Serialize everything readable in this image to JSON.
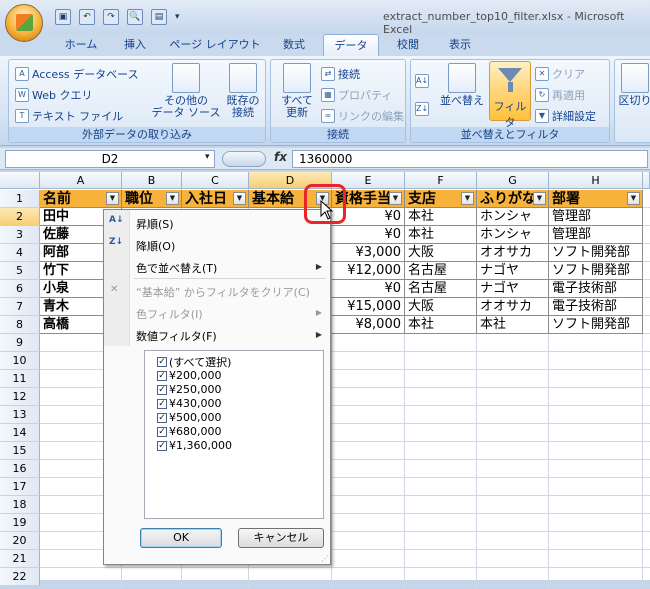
{
  "window": {
    "title": "extract_number_top10_filter.xlsx - Microsoft Excel"
  },
  "tabs": [
    "ホーム",
    "挿入",
    "ページ レイアウト",
    "数式",
    "データ",
    "校閲",
    "表示"
  ],
  "ribbon": {
    "ext": {
      "access": "Access データベース",
      "web": "Web クエリ",
      "text": "テキスト ファイル",
      "other": "その他の",
      "other2": "データ ソース",
      "existing": "既存の",
      "existing2": "接続",
      "label": "外部データの取り込み"
    },
    "conn": {
      "refresh": "すべて",
      "refresh2": "更新",
      "connections": "接続",
      "properties": "プロパティ",
      "links": "リンクの編集",
      "label": "接続"
    },
    "sort": {
      "asc": "A→Z",
      "desc": "Z→A",
      "sort": "並べ替え",
      "filter": "フィルタ",
      "clear": "クリア",
      "reapply": "再適用",
      "advanced": "詳細設定",
      "label": "並べ替えとフィルタ"
    },
    "tools": {
      "split": "区切り"
    }
  },
  "formulabar": {
    "namebox": "D2",
    "fx": "fx",
    "value": "1360000"
  },
  "columns": [
    "A",
    "B",
    "C",
    "D",
    "E",
    "F",
    "G",
    "H"
  ],
  "rows": [
    "1",
    "2",
    "3",
    "4",
    "5",
    "6",
    "7",
    "8",
    "9",
    "10",
    "11",
    "12",
    "13",
    "14",
    "15",
    "16",
    "17",
    "18",
    "19",
    "20",
    "21",
    "22"
  ],
  "headers": [
    "名前",
    "職位",
    "入社日",
    "基本給",
    "資格手当",
    "支店",
    "ふりがな",
    "部署"
  ],
  "table": [
    {
      "name": "田中",
      "allow": "¥0",
      "branch": "本社",
      "kana": "ホンシャ",
      "dept": "管理部"
    },
    {
      "name": "佐藤",
      "allow": "¥0",
      "branch": "本社",
      "kana": "ホンシャ",
      "dept": "管理部"
    },
    {
      "name": "阿部",
      "allow": "¥3,000",
      "branch": "大阪",
      "kana": "オオサカ",
      "dept": "ソフト開発部"
    },
    {
      "name": "竹下",
      "allow": "¥12,000",
      "branch": "名古屋",
      "kana": "ナゴヤ",
      "dept": "ソフト開発部"
    },
    {
      "name": "小泉",
      "allow": "¥0",
      "branch": "名古屋",
      "kana": "ナゴヤ",
      "dept": "電子技術部"
    },
    {
      "name": "青木",
      "allow": "¥15,000",
      "branch": "大阪",
      "kana": "オオサカ",
      "dept": "電子技術部"
    },
    {
      "name": "高橋",
      "allow": "¥8,000",
      "branch": "本社",
      "kana": "本社",
      "dept": "ソフト開発部"
    }
  ],
  "menu": {
    "sort_asc": "昇順(S)",
    "sort_desc": "降順(O)",
    "sort_color": "色で並べ替え(T)",
    "clear": "“基本給” からフィルタをクリア(C)",
    "color_filter": "色フィルタ(I)",
    "number_filter": "数値フィルタ(F)",
    "items": [
      "(すべて選択)",
      "¥200,000",
      "¥250,000",
      "¥430,000",
      "¥500,000",
      "¥680,000",
      "¥1,360,000"
    ],
    "ok": "OK",
    "cancel": "キャンセル"
  }
}
